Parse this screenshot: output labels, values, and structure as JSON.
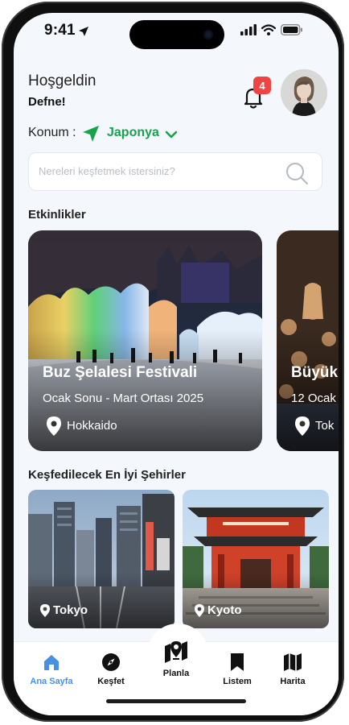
{
  "status_bar": {
    "time": "9:41"
  },
  "header": {
    "greeting": "Hoşgeldin",
    "user_name": "Defne!",
    "notification_count": "4"
  },
  "location": {
    "label": "Konum :",
    "value": "Japonya"
  },
  "search": {
    "placeholder": "Nereleri keşfetmek istersiniz?"
  },
  "events": {
    "title": "Etkinlikler",
    "items": [
      {
        "title": "Buz Şelalesi Festivali",
        "date": "Ocak Sonu - Mart Ortası 2025",
        "place": "Hokkaido"
      },
      {
        "title": "Büyük",
        "date": "12 Ocak",
        "place": "Tok"
      }
    ]
  },
  "cities": {
    "title": "Keşfedilecek En İyi Şehirler",
    "items": [
      {
        "name": "Tokyo"
      },
      {
        "name": "Kyoto"
      }
    ]
  },
  "nav": {
    "items": [
      {
        "label": "Ana Sayfa",
        "icon": "home-icon",
        "active": true
      },
      {
        "label": "Keşfet",
        "icon": "compass-icon"
      },
      {
        "label": "Planla",
        "icon": "map-pin-icon"
      },
      {
        "label": "Listem",
        "icon": "bookmark-icon"
      },
      {
        "label": "Harita",
        "icon": "map-icon"
      }
    ]
  },
  "colors": {
    "accent_green": "#16a34a",
    "active_blue": "#4a90e2",
    "badge_red": "#ef4444"
  }
}
